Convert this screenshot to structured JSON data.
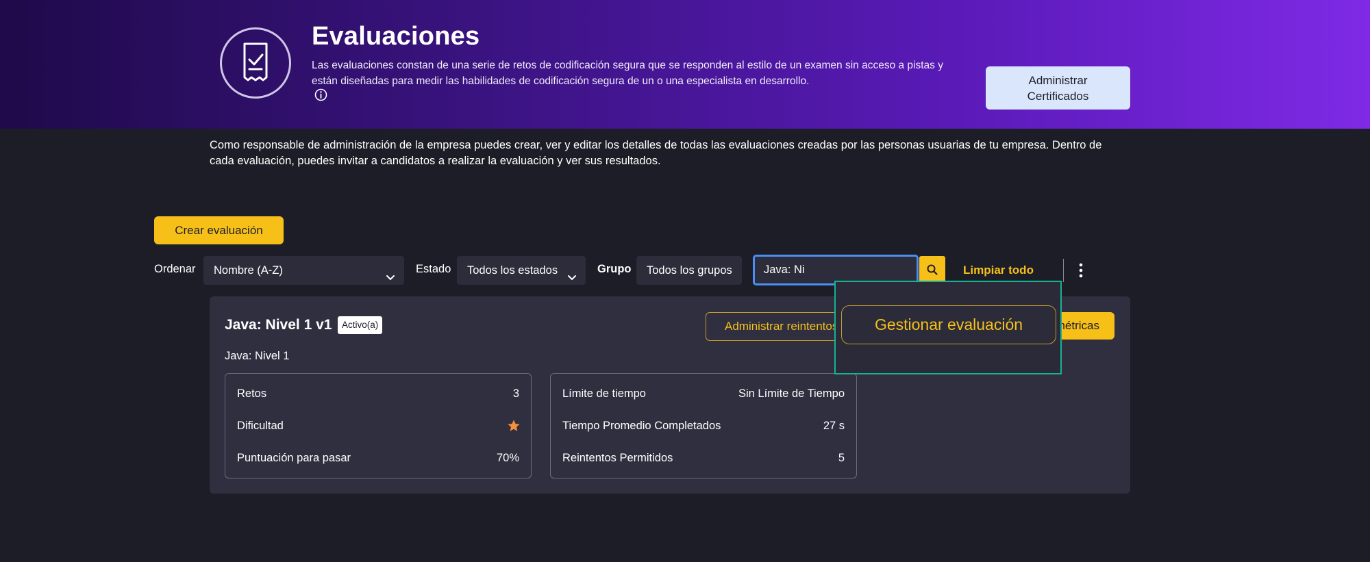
{
  "header": {
    "title": "Evaluaciones",
    "description": "Las evaluaciones constan de una serie de retos de codificación segura que se responden al estilo de un examen sin acceso a pistas y están diseñadas para medir las habilidades de codificación segura de un o una especialista en desarrollo.",
    "manage_certificates_label": "Administrar\nCertificados",
    "icon": "assessment-document-icon"
  },
  "intro_text": "Como responsable de administración de la empresa puedes crear, ver y editar los detalles de todas las evaluaciones creadas por las personas usuarias de tu empresa. Dentro de cada evaluación, puedes invitar a candidatos a realizar la evaluación y ver sus resultados.",
  "toolbar": {
    "create_label": "Crear evaluación",
    "sort_label": "Ordenar",
    "sort_value": "Nombre (A-Z)",
    "status_label": "Estado",
    "status_value": "Todos los estados",
    "group_label": "Grupo",
    "group_value": "Todos los grupos",
    "search_value": "Java: Ni",
    "clear_label": "Limpiar todo"
  },
  "assessment": {
    "title": "Java: Nivel 1 v1",
    "status_badge": "Activo(a)",
    "subtitle": "Java: Nivel 1",
    "retries_button": "Administrar reintentos",
    "metrics_button": "Ver métricas",
    "left_stats": [
      {
        "label": "Retos",
        "value": "3"
      },
      {
        "label": "Dificultad",
        "value": ""
      },
      {
        "label": "Puntuación para pasar",
        "value": "70%"
      }
    ],
    "difficulty_stars": 1,
    "right_stats": [
      {
        "label": "Límite de tiempo",
        "value": "Sin Límite de Tiempo"
      },
      {
        "label": "Tiempo Promedio Completados",
        "value": "27 s"
      },
      {
        "label": "Reintentos Permitidos",
        "value": "5"
      }
    ]
  },
  "dropdown_menu": {
    "manage_label": "Gestionar evaluación"
  },
  "colors": {
    "accent": "#f6c018",
    "background": "#1d1d27",
    "card": "#302f40",
    "focus": "#4a8ff5",
    "menu_outline": "#17b290",
    "star": "#f5913b"
  }
}
